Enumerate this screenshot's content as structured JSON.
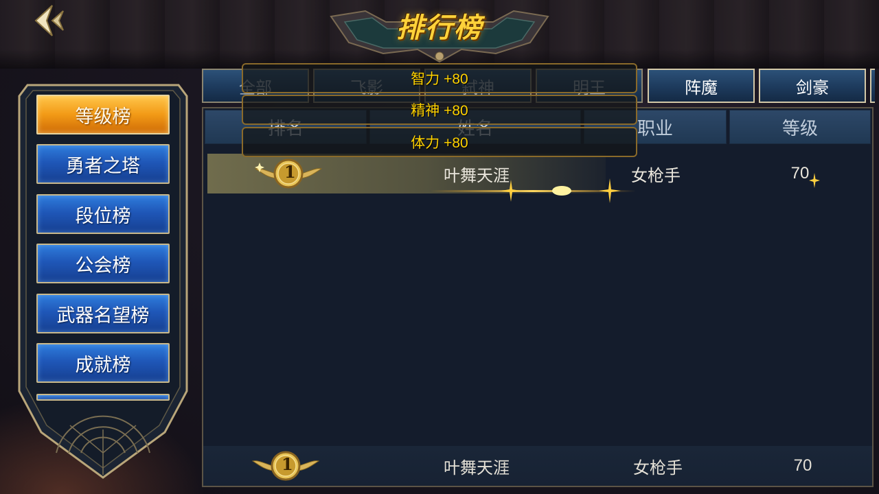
{
  "title": "排行榜",
  "colors": {
    "accent_gold": "#ffd23a",
    "active_tab_orange": "#f29a16",
    "tab_blue": "#1f57b8",
    "tooltip_text": "#ffd200"
  },
  "sidebar": {
    "items": [
      {
        "label": "等级榜",
        "active": true
      },
      {
        "label": "勇者之塔",
        "active": false
      },
      {
        "label": "段位榜",
        "active": false
      },
      {
        "label": "公会榜",
        "active": false
      },
      {
        "label": "武器名望榜",
        "active": false
      },
      {
        "label": "成就榜",
        "active": false
      }
    ]
  },
  "class_tabs": [
    {
      "label": "全部"
    },
    {
      "label": "飞影"
    },
    {
      "label": "弑神"
    },
    {
      "label": "明王"
    },
    {
      "label": "阵魔"
    },
    {
      "label": "剑豪"
    }
  ],
  "table": {
    "headers": [
      "排名",
      "姓名",
      "职业",
      "等级"
    ],
    "rows": [
      {
        "rank": "1",
        "name": "叶舞天涯",
        "class": "女枪手",
        "level": "70"
      }
    ]
  },
  "my_rank": {
    "rank": "1",
    "name": "叶舞天涯",
    "class": "女枪手",
    "level": "70"
  },
  "tooltip": {
    "lines": [
      "智力 +80",
      "精神 +80",
      "体力 +80"
    ]
  },
  "icons": {
    "back": "back-arrow-icon",
    "medal": "winged-medal-icon",
    "sparkle": "sparkle-icon"
  }
}
